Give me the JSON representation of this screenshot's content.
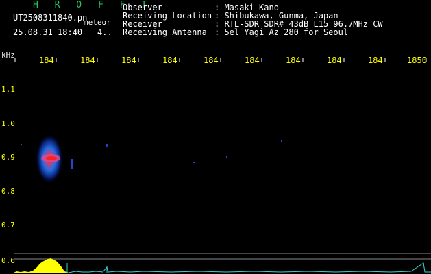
{
  "header": {
    "brand": "H R O F F T",
    "filename": "UT2508311840.pn",
    "file_type": "meteor",
    "datetime": "25.08.31 18:40",
    "count": "4..",
    "info": [
      {
        "label": "Observer",
        "value": ": Masaki Kano"
      },
      {
        "label": "Receiving Location",
        "value": ": Shibukawa, Gunma, Japan"
      },
      {
        "label": "Receiver",
        "value": ": RTL-SDR SDR# 43dB L15 96.7MHz CW"
      },
      {
        "label": "Receiving Antenna",
        "value": ": 5el Yagi Az 280 for Seoul"
      }
    ]
  },
  "chart_data": {
    "type": "heatmap",
    "y_unit_label": "kHz",
    "x_tick_labels": [
      "184",
      "184",
      "184",
      "184",
      "184",
      "184",
      "184",
      "184",
      "184",
      "1850"
    ],
    "y_tick_labels": [
      "1.1",
      "1.0",
      "0.9",
      "0.8",
      "0.7",
      "0.6"
    ],
    "ylim": [
      0.6,
      1.1
    ],
    "grid": false,
    "colors": {
      "background": "#000000",
      "tick_text": "#ffff00",
      "signal_core": "#ff2020",
      "signal_halo": "#1e6bff",
      "baseline_trace": "#3ad0d0",
      "peak_fill": "#ffff00"
    },
    "meteor_echo": {
      "start_minute": 1840.5,
      "frequency_khz": 0.9,
      "strength": "strong"
    }
  }
}
